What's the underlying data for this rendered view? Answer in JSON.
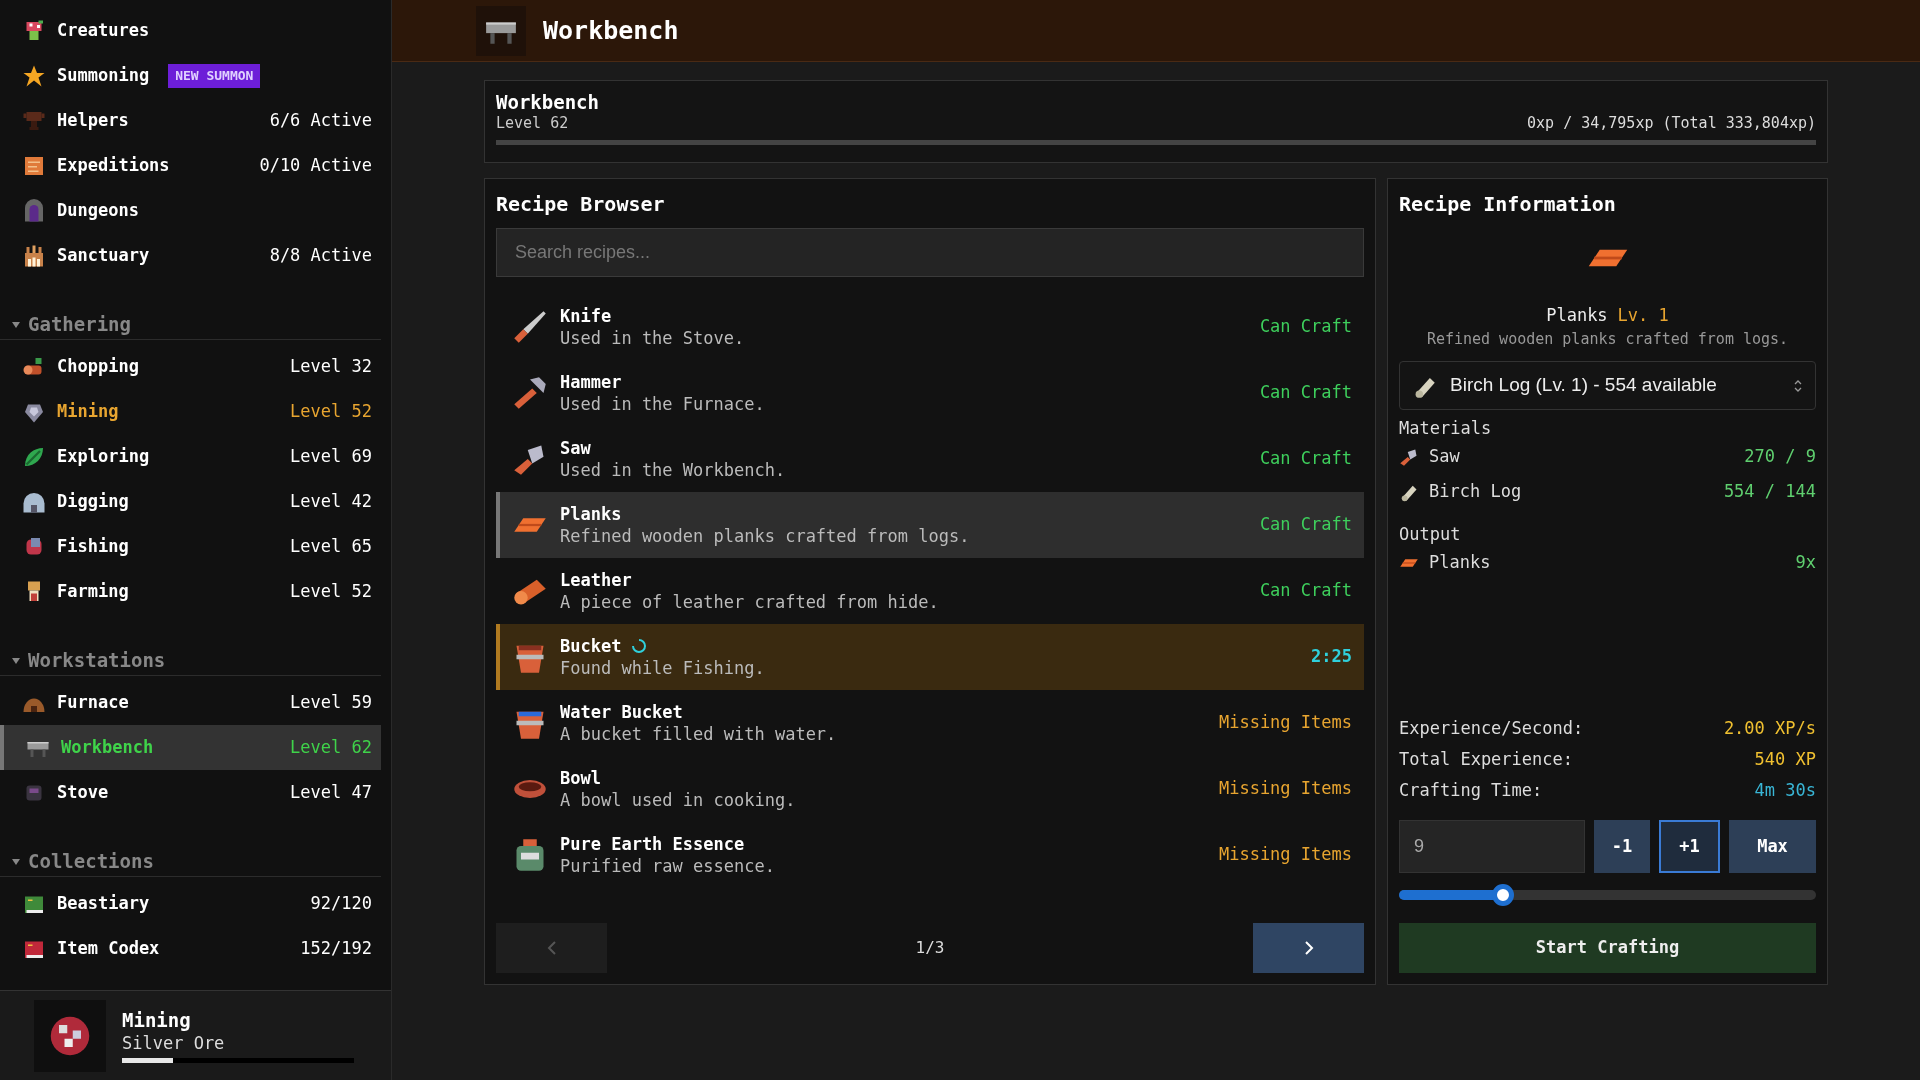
{
  "sidebar": {
    "items": [
      {
        "label": "Creatures",
        "selected": false
      },
      {
        "label": "Summoning",
        "badge": "NEW SUMMON",
        "selected": false
      },
      {
        "label": "Helpers",
        "value": "6/6 Active",
        "selected": false
      },
      {
        "label": "Expeditions",
        "value": "0/10 Active",
        "selected": false
      },
      {
        "label": "Dungeons",
        "selected": false
      },
      {
        "label": "Sanctuary",
        "value": "8/8 Active",
        "selected": false
      }
    ],
    "sections": [
      {
        "title": "Gathering",
        "expanded": true,
        "items": [
          {
            "label": "Chopping",
            "value": "Level 32",
            "selected": false,
            "active": false
          },
          {
            "label": "Mining",
            "value": "Level 52",
            "selected": false,
            "active": true
          },
          {
            "label": "Exploring",
            "value": "Level 69",
            "selected": false,
            "active": false
          },
          {
            "label": "Digging",
            "value": "Level 42",
            "selected": false,
            "active": false
          },
          {
            "label": "Fishing",
            "value": "Level 65",
            "selected": false,
            "active": false
          },
          {
            "label": "Farming",
            "value": "Level 52",
            "selected": false,
            "active": false
          }
        ]
      },
      {
        "title": "Workstations",
        "expanded": true,
        "items": [
          {
            "label": "Furnace",
            "value": "Level 59",
            "selected": false,
            "active": false
          },
          {
            "label": "Workbench",
            "value": "Level 62",
            "selected": true,
            "active": false
          },
          {
            "label": "Stove",
            "value": "Level 47",
            "selected": false,
            "active": false
          }
        ]
      },
      {
        "title": "Collections",
        "expanded": true,
        "items": [
          {
            "label": "Beastiary",
            "value": "92/120",
            "selected": false,
            "active": false
          },
          {
            "label": "Item Codex",
            "value": "152/192",
            "selected": false,
            "active": false
          }
        ]
      }
    ]
  },
  "current_activity": {
    "title": "Mining",
    "item": "Silver Ore",
    "level": 0.22
  },
  "header": {
    "title": "Workbench"
  },
  "station": {
    "name": "Workbench",
    "level_text": "Level 62",
    "xp": "0xp / 34,795xp (Total 333,804xp)",
    "progress": {
      "level": 0
    }
  },
  "recipe_browser": {
    "title": "Recipe Browser",
    "search": {
      "placeholder": "Search recipes..."
    },
    "recipes": [
      {
        "name": "Knife",
        "description": "Used in the Stove.",
        "status": "Can Craft",
        "kind": "can_craft",
        "selected": false,
        "in_progress": false
      },
      {
        "name": "Hammer",
        "description": "Used in the Furnace.",
        "status": "Can Craft",
        "kind": "can_craft",
        "selected": false,
        "in_progress": false
      },
      {
        "name": "Saw",
        "description": "Used in the Workbench.",
        "status": "Can Craft",
        "kind": "can_craft",
        "selected": false,
        "in_progress": false
      },
      {
        "name": "Planks",
        "description": "Refined wooden planks crafted from logs.",
        "status": "Can Craft",
        "kind": "can_craft",
        "selected": true,
        "in_progress": false
      },
      {
        "name": "Leather",
        "description": "A piece of leather crafted from hide.",
        "status": "Can Craft",
        "kind": "can_craft",
        "selected": false,
        "in_progress": false
      },
      {
        "name": "Bucket",
        "description": "Found while Fishing.",
        "status": "2:25",
        "kind": "timer",
        "selected": false,
        "in_progress": true
      },
      {
        "name": "Water Bucket",
        "description": "A bucket filled with water.",
        "status": "Missing Items",
        "kind": "missing",
        "selected": false,
        "in_progress": false
      },
      {
        "name": "Bowl",
        "description": "A bowl used in cooking.",
        "status": "Missing Items",
        "kind": "missing",
        "selected": false,
        "in_progress": false
      },
      {
        "name": "Pure Earth Essence",
        "description": "Purified raw essence.",
        "status": "Missing Items",
        "kind": "missing",
        "selected": false,
        "in_progress": false
      }
    ],
    "pagination": {
      "page": "1/3",
      "prev_disabled": true,
      "next_disabled": false
    }
  },
  "recipe_info": {
    "title": "Recipe Information",
    "name": "Planks",
    "level": "Lv. 1",
    "description": "Refined wooden planks crafted from logs.",
    "material_select": {
      "value": "Birch Log (Lv. 1) - 554 available"
    },
    "materials_title": "Materials",
    "materials": [
      {
        "name": "Saw",
        "amount": "270 / 9"
      },
      {
        "name": "Birch Log",
        "amount": "554 / 144"
      }
    ],
    "output_title": "Output",
    "output": [
      {
        "name": "Planks",
        "amount": "9x"
      }
    ],
    "stats": [
      {
        "label": "Experience/Second:",
        "value": "2.00 XP/s",
        "kind": "xp"
      },
      {
        "label": "Total Experience:",
        "value": "540 XP",
        "kind": "xp"
      },
      {
        "label": "Crafting Time:",
        "value": "4m 30s",
        "kind": "time"
      }
    ],
    "quantity": {
      "value": "9"
    },
    "buttons": [
      {
        "label": "-1",
        "focused": false
      },
      {
        "label": "+1",
        "focused": true
      },
      {
        "label": "Max",
        "focused": false
      }
    ],
    "slider": {
      "level": 0.25
    },
    "start_button": "Start Crafting"
  }
}
